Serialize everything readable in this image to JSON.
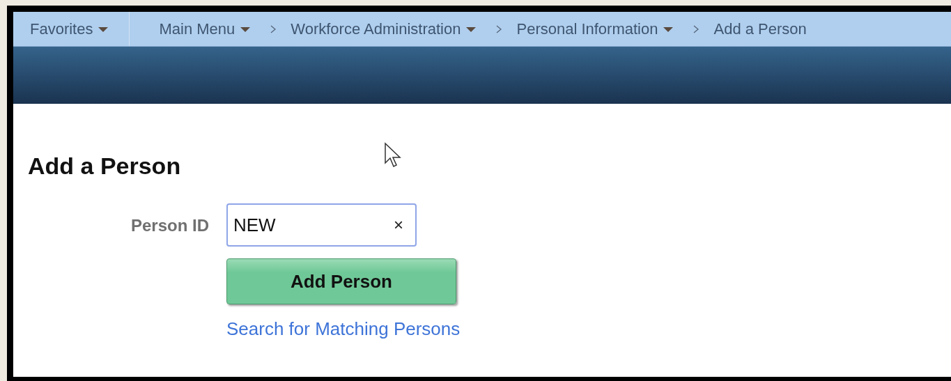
{
  "breadcrumbs": [
    {
      "label": "Favorites",
      "dropdown": true,
      "kind": "menu"
    },
    {
      "label": "Main Menu",
      "dropdown": true,
      "kind": "menu"
    },
    {
      "label": "Workforce Administration",
      "dropdown": true,
      "kind": "crumb"
    },
    {
      "label": "Personal Information",
      "dropdown": true,
      "kind": "crumb"
    },
    {
      "label": "Add a Person",
      "dropdown": false,
      "kind": "crumb"
    }
  ],
  "page_title": "Add a Person",
  "form": {
    "label": "Person ID",
    "value": "NEW",
    "clear": "×",
    "button": "Add Person",
    "link": "Search for Matching Persons"
  }
}
